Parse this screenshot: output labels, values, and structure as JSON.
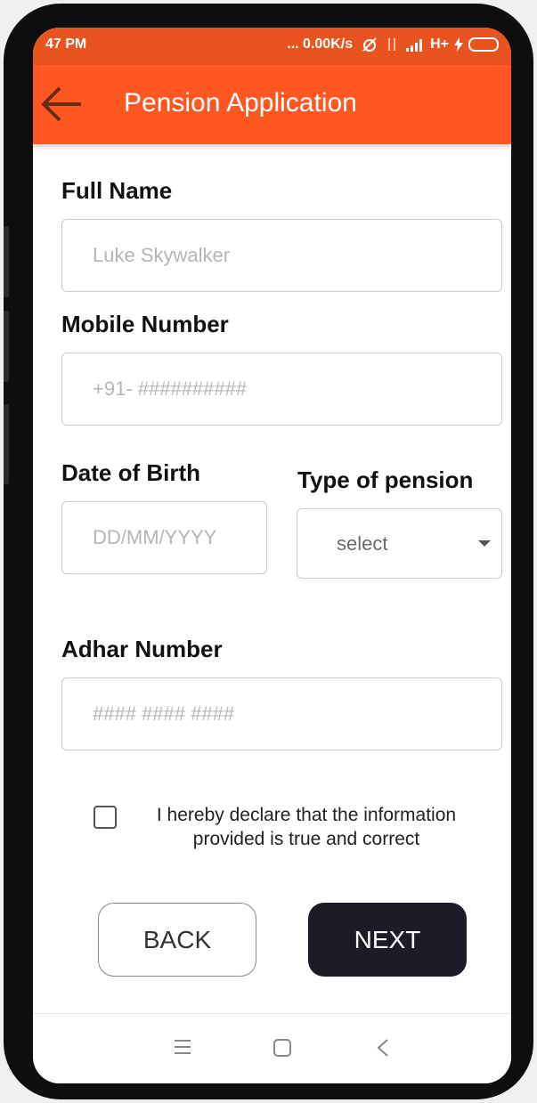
{
  "status_bar": {
    "time": "47 PM",
    "network_speed": "... 0.00K/s",
    "network_type": "H+"
  },
  "app_bar": {
    "title": "Pension Application",
    "back_icon": "arrow-left-icon"
  },
  "form": {
    "full_name": {
      "label": "Full Name",
      "placeholder": "Luke Skywalker"
    },
    "mobile": {
      "label": "Mobile Number",
      "placeholder": "+91- ##########"
    },
    "dob": {
      "label": "Date of Birth",
      "placeholder": "DD/MM/YYYY"
    },
    "pension_type": {
      "label": "Type of pension",
      "value": "select"
    },
    "adhar": {
      "label": "Adhar Number",
      "placeholder": "#### #### ####"
    },
    "declaration": {
      "text": "I hereby declare that the information provided is true and correct",
      "checked": false
    }
  },
  "buttons": {
    "back_label": "BACK",
    "next_label": "NEXT"
  },
  "nav_bar": {
    "icons": [
      "menu-icon",
      "home-square-icon",
      "back-chevron-icon"
    ]
  },
  "colors": {
    "status_bar": "#e8531f",
    "app_bar": "#fe5722",
    "next_button": "#1c1b27"
  }
}
